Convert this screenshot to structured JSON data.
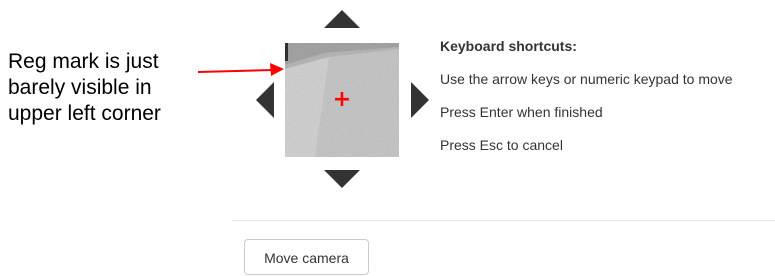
{
  "annotation": {
    "text": "Reg mark is just\nbarely visible in\nupper left corner",
    "color": "#000000",
    "arrow_color": "#ff0000"
  },
  "jog_controls": {
    "up_icon": "triangle-up-icon",
    "down_icon": "triangle-down-icon",
    "left_icon": "triangle-left-icon",
    "right_icon": "triangle-right-icon",
    "color": "#333333"
  },
  "camera": {
    "crosshair": "+",
    "crosshair_color": "#ff0000"
  },
  "shortcuts": {
    "title": "Keyboard shortcuts:",
    "lines": [
      "Use the arrow keys or numeric keypad to move",
      "Press Enter when finished",
      "Press Esc to cancel"
    ]
  },
  "footer": {
    "move_camera_label": "Move camera"
  }
}
